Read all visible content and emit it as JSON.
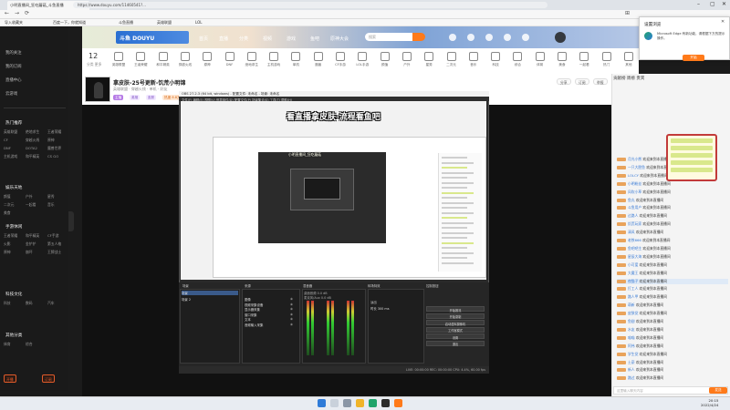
{
  "overlay_caption": "看直播拿皮肤-流程看鱼吧",
  "browser": {
    "tabs": [
      "小明直播间_狂吃蘑菇_斗鱼直播",
      "+"
    ],
    "url": "https://www.douyu.com/11460541?...",
    "favorites": [
      "导入收藏夹",
      "百度一下，你就知道",
      "斗鱼直播",
      "英雄联盟",
      "LOL",
      "哔哩哔哩",
      "腾讯视频",
      "微博"
    ]
  },
  "douyu": {
    "logo": "斗鱼 DOUYU",
    "nav": [
      "首页",
      "直播",
      "分类",
      "视频",
      "游戏",
      "鱼吧",
      "原神大会"
    ],
    "search_placeholder": "搜索",
    "category_count": "12",
    "category_sub": "分类 更多",
    "categories": [
      "英雄联盟",
      "王者荣耀",
      "和平精英",
      "穿越火线",
      "原神",
      "DNF",
      "绝地求生",
      "主机游戏",
      "单机",
      "魔兽",
      "CF手游",
      "LOL手游",
      "颜值",
      "户外",
      "星秀",
      "二次元",
      "音乐",
      "科技",
      "综合",
      "体育",
      "美食",
      "一起看",
      "热门",
      "其他"
    ]
  },
  "sidebar": {
    "items": [
      "我的关注",
      "我的订阅",
      "直播中心",
      "云游戏"
    ],
    "section1": "热门推荐",
    "section1_cells": [
      "英雄联盟",
      "绝地求生",
      "王者荣耀",
      "CF",
      "穿越火线",
      "原神",
      "DNF",
      "DOTA2",
      "魔兽世界",
      "主机游戏",
      "和平精英",
      "CS GO"
    ],
    "section2": "娱乐天地",
    "section2_cells": [
      "颜值",
      "户外",
      "星秀",
      "二次元",
      "一起看",
      "音乐",
      "美食"
    ],
    "section3": "手游休闲",
    "section3_cells": [
      "王者荣耀",
      "和平精英",
      "CF手游",
      "火影",
      "金铲铲",
      "第五人格",
      "原神",
      "崩坏",
      "王牌战士"
    ],
    "section4": "科技文化",
    "section4_cells": [
      "科技",
      "数码",
      "汽车"
    ],
    "section5": "其他分类",
    "section5_cells": [
      "体育",
      "综合"
    ],
    "btn_open": "开播",
    "btn_follow": "订阅"
  },
  "room": {
    "title": "拿皮肤-25号更新-饥荒小明锦",
    "meta": "英雄联盟 · 穿越火线 · 单机 · 好友",
    "tags": [
      "主播",
      "英雄",
      "皮肤",
      "热度 8.8万"
    ],
    "btns": [
      "分享",
      "订阅",
      "举报"
    ]
  },
  "obs": {
    "title": "OBS 27.2.3 (64 bit, windows) - 配置文件: 未命名 - 场景: 未命名",
    "menu": "文件(F)  编辑(E)  视图(V)  停靠部件(D)  配置文件(P)  场景集合(S)  工具(T)  帮助(H)",
    "preview_caption": "看直播拿皮肤-流程看鱼吧",
    "preview_sub": "小明直播间_狂吃蘑菇",
    "dock_titles": [
      "场景",
      "来源",
      "混音器",
      "转场特效",
      "控制按钮"
    ],
    "scenes": [
      "场景",
      "场景 2"
    ],
    "sources": [
      "图像",
      "视频采集设备",
      "显示器采集",
      "窗口采集",
      "文本",
      "音频输入采集"
    ],
    "mixer": [
      "桌面音频 0.0 dB",
      "麦克风/Aux 0.0 dB",
      "音频输入采集"
    ],
    "transition": [
      "淡出",
      "时长 300 ms"
    ],
    "controls": [
      "开始推流",
      "开始录制",
      "启动虚拟摄像机",
      "工作室模式",
      "设置",
      "退出"
    ],
    "status": "LIVE: 00:00:00   REC: 00:00:00   CPU: 4.4%, 60.00 fps"
  },
  "chat": {
    "header": "贡献榜  周榜  贵宾",
    "messages": [
      {
        "name": "月光小熊",
        "text": "欢迎来到本直播间"
      },
      {
        "name": "一只大肥鱼",
        "text": "欢迎来到本直播间"
      },
      {
        "name": "LOLCY",
        "text": "欢迎来到本直播间"
      },
      {
        "name": "小明粉丝",
        "text": "欢迎来到本直播间"
      },
      {
        "name": "风吹小草",
        "text": "欢迎来到本直播间"
      },
      {
        "name": "鱼丸",
        "text": "欢迎来到本直播间"
      },
      {
        "name": "斗鱼用户",
        "text": "欢迎来到本直播间"
      },
      {
        "name": "过路人",
        "text": "欢迎来到本直播间"
      },
      {
        "name": "饥荒玩家",
        "text": "欢迎来到本直播间"
      },
      {
        "name": "清风",
        "text": "欢迎来到本直播间"
      },
      {
        "name": "老铁666",
        "text": "欢迎来到本直播间"
      },
      {
        "name": "鱼吧吧主",
        "text": "欢迎来到本直播间"
      },
      {
        "name": "星辰大海",
        "text": "欢迎来到本直播间"
      },
      {
        "name": "小可爱",
        "text": "欢迎来到本直播间"
      },
      {
        "name": "大魔王",
        "text": "欢迎来到本直播间"
      },
      {
        "name": "夜猫子",
        "text": "欢迎来到本直播间"
      },
      {
        "name": "打工人",
        "text": "欢迎来到本直播间"
      },
      {
        "name": "路人甲",
        "text": "欢迎来到本直播间"
      },
      {
        "name": "萌新",
        "text": "欢迎来到本直播间"
      },
      {
        "name": "皮肤党",
        "text": "欢迎来到本直播间"
      },
      {
        "name": "鱼翅",
        "text": "欢迎来到本直播间"
      },
      {
        "name": "水友",
        "text": "欢迎来到本直播间"
      },
      {
        "name": "喵喵",
        "text": "欢迎来到本直播间"
      },
      {
        "name": "阿伟",
        "text": "欢迎来到本直播间"
      },
      {
        "name": "学生党",
        "text": "欢迎来到本直播间"
      },
      {
        "name": "土豪",
        "text": "欢迎来到本直播间"
      },
      {
        "name": "新人",
        "text": "欢迎来到本直播间"
      },
      {
        "name": "路过",
        "text": "欢迎来到本直播间"
      }
    ],
    "input_placeholder": "这里输入聊天内容",
    "send": "发送"
  },
  "notification": {
    "title": "设置浏览",
    "text": "Microsoft Edge 有新功能，请根据下方的提示操作。",
    "button": "开始"
  },
  "taskbar": {
    "time": "20:15",
    "date": "2022/4/24"
  },
  "colors": {
    "accent": "#ff7a1a",
    "obs_bg": "#2b2b2b",
    "highlight_box": "#c23a3a"
  }
}
